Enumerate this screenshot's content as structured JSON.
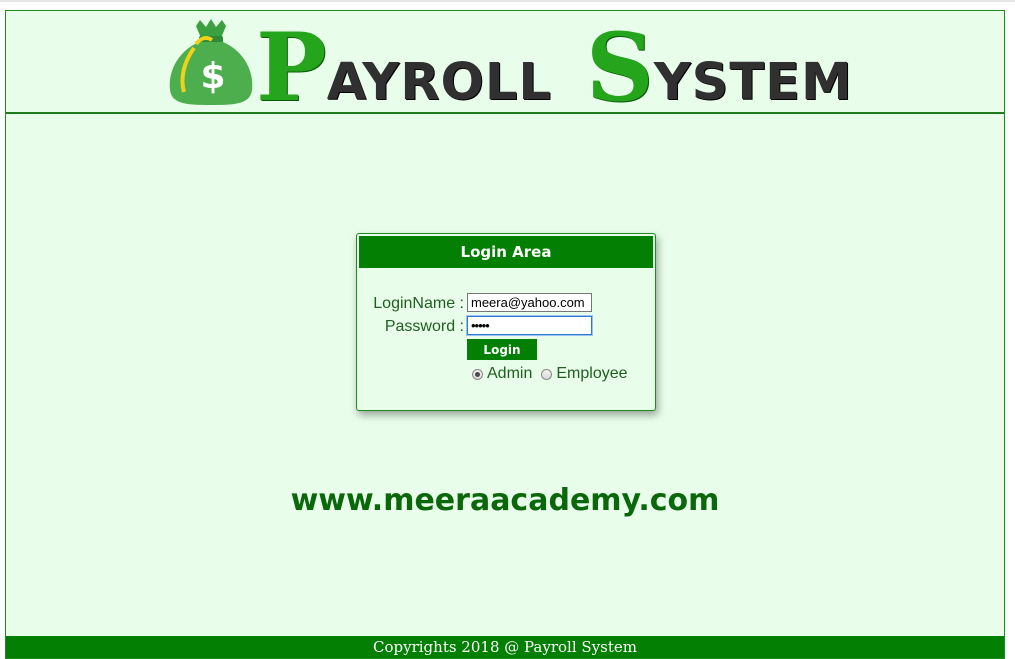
{
  "header": {
    "title_word1_cap": "P",
    "title_word1_rest": "AYROLL",
    "title_word2_cap": "S",
    "title_word2_rest": "YSTEM",
    "logo_icon": "money-bag-icon",
    "logo_symbol": "$"
  },
  "login": {
    "heading": "Login Area",
    "login_name_label": "LoginName :",
    "login_name_value": "meera@yahoo.com",
    "password_label": "Password :",
    "password_value": "•••••",
    "button_label": "Login",
    "roles": [
      {
        "label": "Admin",
        "checked": true
      },
      {
        "label": "Employee",
        "checked": false
      }
    ]
  },
  "website": "www.meeraacademy.com",
  "footer": {
    "text": "Copyrights 2018 @ Payroll System"
  },
  "colors": {
    "accent_green": "#037f03",
    "background": "#e8fdea",
    "title_green": "#25a51c"
  }
}
